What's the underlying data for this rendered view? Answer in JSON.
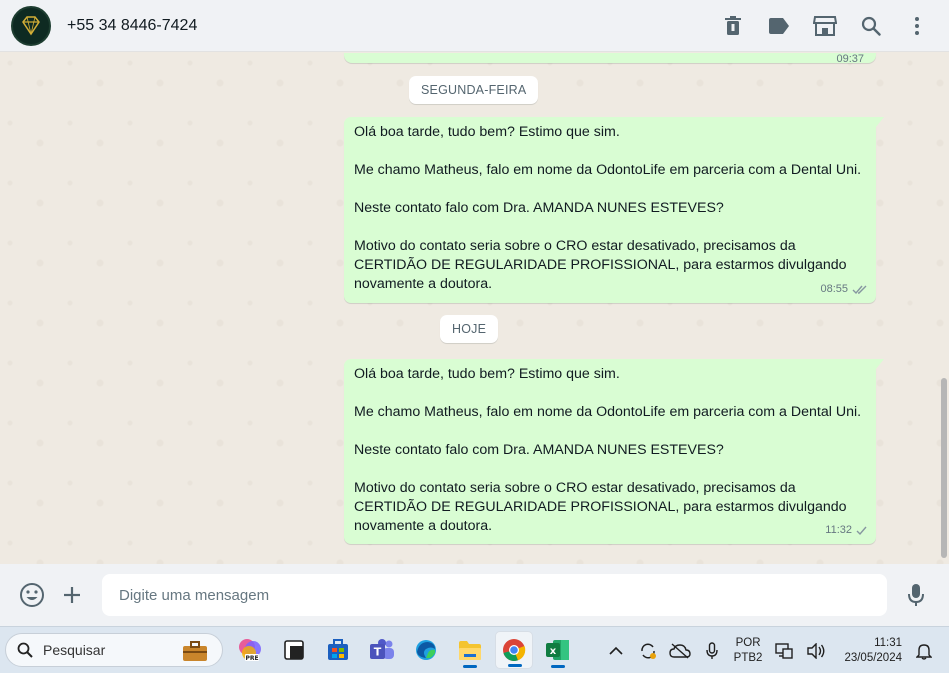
{
  "header": {
    "contact": "+55 34 8446-7424"
  },
  "chat": {
    "previous_time": "09:37",
    "dates": {
      "first": "SEGUNDA-FEIRA",
      "second": "HOJE"
    },
    "messages": [
      {
        "lines": [
          "Olá boa tarde, tudo bem? Estimo que sim.",
          "Me chamo Matheus, falo em nome da OdontoLife em parceria com a Dental Uni.",
          "Neste contato falo com Dra. AMANDA NUNES ESTEVES?",
          "Motivo do contato seria sobre o CRO estar desativado, precisamos da CERTIDÃO DE REGULARIDADE PROFISSIONAL, para estarmos divulgando novamente a doutora."
        ],
        "time": "08:55",
        "status": "read"
      },
      {
        "lines": [
          "Olá boa tarde, tudo bem? Estimo que sim.",
          "Me chamo Matheus, falo em nome da OdontoLife em parceria com a Dental Uni.",
          "Neste contato falo com Dra. AMANDA NUNES ESTEVES?",
          "Motivo do contato seria sobre o CRO estar desativado, precisamos da CERTIDÃO DE REGULARIDADE PROFISSIONAL, para estarmos divulgando novamente a doutora."
        ],
        "time": "11:32",
        "status": "sent"
      }
    ]
  },
  "composer": {
    "placeholder": "Digite uma mensagem"
  },
  "taskbar": {
    "search_label": "Pesquisar",
    "lang_line1": "POR",
    "lang_line2": "PTB2",
    "time": "11:31",
    "date": "23/05/2024"
  },
  "colors": {
    "outgoing_bubble": "#d9fdd3",
    "chat_background": "#efeae2",
    "read_tick": "#53bdeb"
  }
}
